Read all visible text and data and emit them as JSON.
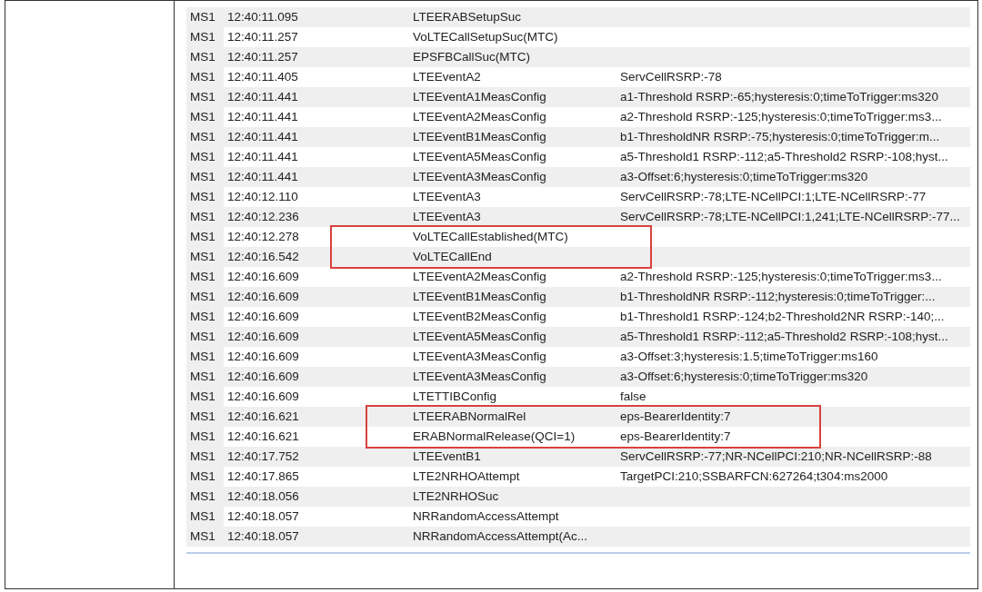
{
  "table": {
    "rows": [
      {
        "device": "MS1",
        "time": "12:40:11.095",
        "event": "LTEERABSetupSuc",
        "details": "",
        "marked": false
      },
      {
        "device": "MS1",
        "time": "12:40:11.257",
        "event": "VoLTECallSetupSuc(MTC)",
        "details": "",
        "marked": false
      },
      {
        "device": "MS1",
        "time": "12:40:11.257",
        "event": "EPSFBCallSuc(MTC)",
        "details": "",
        "marked": false
      },
      {
        "device": "MS1",
        "time": "12:40:11.405",
        "event": "LTEEventA2",
        "details": "ServCellRSRP:-78",
        "marked": false
      },
      {
        "device": "MS1",
        "time": "12:40:11.441",
        "event": "LTEEventA1MeasConfig",
        "details": "a1-Threshold RSRP:-65;hysteresis:0;timeToTrigger:ms320",
        "marked": false
      },
      {
        "device": "MS1",
        "time": "12:40:11.441",
        "event": "LTEEventA2MeasConfig",
        "details": "a2-Threshold RSRP:-125;hysteresis:0;timeToTrigger:ms3...",
        "marked": false
      },
      {
        "device": "MS1",
        "time": "12:40:11.441",
        "event": "LTEEventB1MeasConfig",
        "details": "b1-ThresholdNR RSRP:-75;hysteresis:0;timeToTrigger:m...",
        "marked": false
      },
      {
        "device": "MS1",
        "time": "12:40:11.441",
        "event": "LTEEventA5MeasConfig",
        "details": "a5-Threshold1 RSRP:-112;a5-Threshold2 RSRP:-108;hyst...",
        "marked": false
      },
      {
        "device": "MS1",
        "time": "12:40:11.441",
        "event": "LTEEventA3MeasConfig",
        "details": "a3-Offset:6;hysteresis:0;timeToTrigger:ms320",
        "marked": false
      },
      {
        "device": "MS1",
        "time": "12:40:12.110",
        "event": "LTEEventA3",
        "details": "ServCellRSRP:-78;LTE-NCellPCI:1;LTE-NCellRSRP:-77",
        "marked": false
      },
      {
        "device": "MS1",
        "time": "12:40:12.236",
        "event": "LTEEventA3",
        "details": "ServCellRSRP:-78;LTE-NCellPCI:1,241;LTE-NCellRSRP:-77...",
        "marked": false
      },
      {
        "device": "MS1",
        "time": "12:40:12.278",
        "event": "VoLTECallEstablished(MTC)",
        "details": "",
        "marked": true
      },
      {
        "device": "MS1",
        "time": "12:40:16.542",
        "event": "VoLTECallEnd",
        "details": "",
        "marked": true
      },
      {
        "device": "MS1",
        "time": "12:40:16.609",
        "event": "LTEEventA2MeasConfig",
        "details": "a2-Threshold RSRP:-125;hysteresis:0;timeToTrigger:ms3...",
        "marked": false
      },
      {
        "device": "MS1",
        "time": "12:40:16.609",
        "event": "LTEEventB1MeasConfig",
        "details": "b1-ThresholdNR RSRP:-112;hysteresis:0;timeToTrigger:...",
        "marked": false
      },
      {
        "device": "MS1",
        "time": "12:40:16.609",
        "event": "LTEEventB2MeasConfig",
        "details": "b1-Threshold1 RSRP:-124;b2-Threshold2NR RSRP:-140;...",
        "marked": false
      },
      {
        "device": "MS1",
        "time": "12:40:16.609",
        "event": "LTEEventA5MeasConfig",
        "details": "a5-Threshold1 RSRP:-112;a5-Threshold2 RSRP:-108;hyst...",
        "marked": false
      },
      {
        "device": "MS1",
        "time": "12:40:16.609",
        "event": "LTEEventA3MeasConfig",
        "details": "a3-Offset:3;hysteresis:1.5;timeToTrigger:ms160",
        "marked": false
      },
      {
        "device": "MS1",
        "time": "12:40:16.609",
        "event": "LTEEventA3MeasConfig",
        "details": "a3-Offset:6;hysteresis:0;timeToTrigger:ms320",
        "marked": false
      },
      {
        "device": "MS1",
        "time": "12:40:16.609",
        "event": "LTETTIBConfig",
        "details": "false",
        "marked": false
      },
      {
        "device": "MS1",
        "time": "12:40:16.621",
        "event": "LTEERABNormalRel",
        "details": "eps-BearerIdentity:7",
        "marked": true
      },
      {
        "device": "MS1",
        "time": "12:40:16.621",
        "event": "ERABNormalRelease(QCI=1)",
        "details": "eps-BearerIdentity:7",
        "marked": true
      },
      {
        "device": "MS1",
        "time": "12:40:17.752",
        "event": "LTEEventB1",
        "details": "ServCellRSRP:-77;NR-NCellPCI:210;NR-NCellRSRP:-88",
        "marked": false
      },
      {
        "device": "MS1",
        "time": "12:40:17.865",
        "event": "LTE2NRHOAttempt",
        "details": "TargetPCI:210;SSBARFCN:627264;t304:ms2000",
        "marked": false
      },
      {
        "device": "MS1",
        "time": "12:40:18.056",
        "event": "LTE2NRHOSuc",
        "details": "",
        "marked": false
      },
      {
        "device": "MS1",
        "time": "12:40:18.057",
        "event": "NRRandomAccessAttempt",
        "details": "",
        "marked": false
      },
      {
        "device": "MS1",
        "time": "12:40:18.057",
        "event": "NRRandomAccessAttempt(Ac...",
        "details": "",
        "marked": false
      }
    ]
  }
}
